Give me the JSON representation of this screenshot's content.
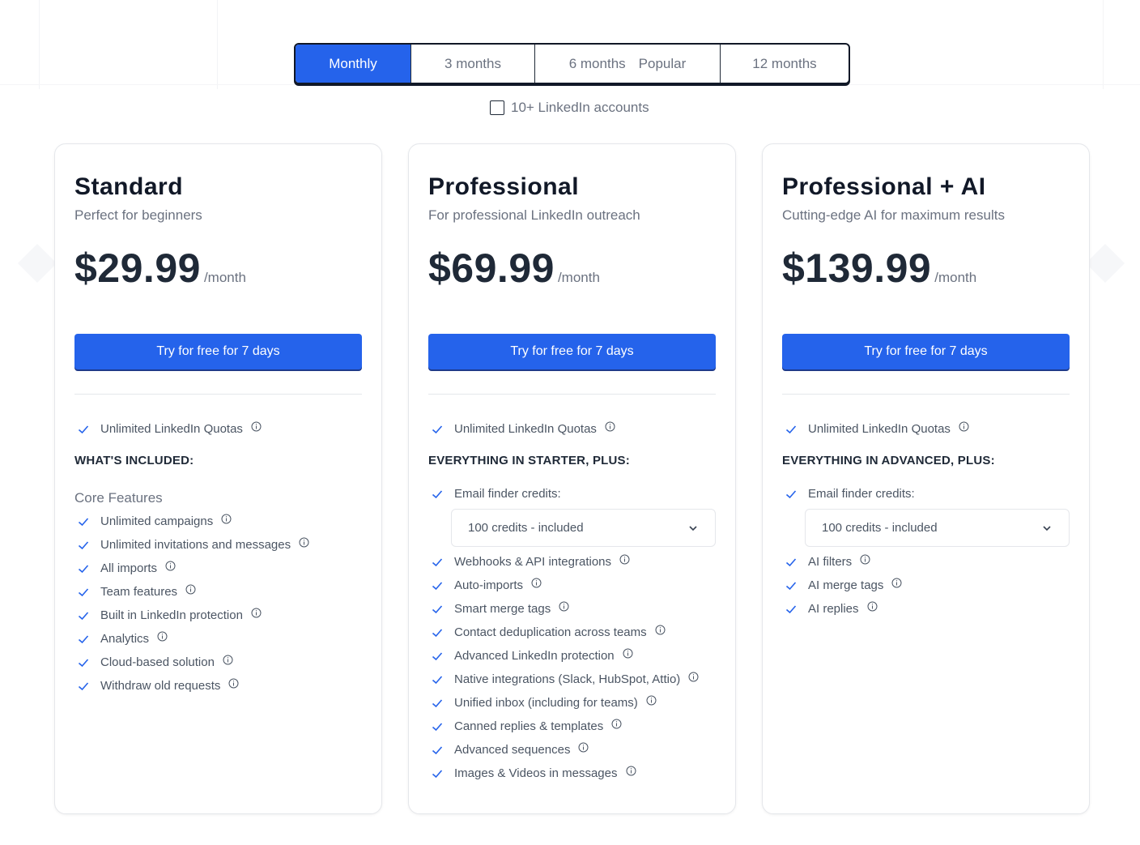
{
  "billing": {
    "options": [
      {
        "label": "Monthly"
      },
      {
        "label": "3 months"
      },
      {
        "label": "6 months",
        "tag": "Popular"
      },
      {
        "label": "12 months"
      }
    ],
    "selected": "Monthly",
    "accounts_label": "10+ LinkedIn accounts",
    "accounts_checked": false
  },
  "colors": {
    "accent": "#2563eb",
    "check": "#2563eb",
    "text": "#1f2937",
    "muted": "#6b7280"
  },
  "plans": [
    {
      "title": "Standard",
      "subtitle": "Perfect for beginners",
      "price": "$29.99",
      "unit": "/month",
      "cta": "Try for free for 7 days",
      "quota": "Unlimited LinkedIn Quotas",
      "heading": "WHAT'S INCLUDED:",
      "group": "Core Features",
      "features": [
        "Unlimited campaigns",
        "Unlimited invitations and messages",
        "All imports",
        "Team features",
        "Built in LinkedIn protection",
        "Analytics",
        "Cloud-based solution",
        "Withdraw old requests"
      ]
    },
    {
      "title": "Professional",
      "subtitle": "For professional LinkedIn outreach",
      "price": "$69.99",
      "unit": "/month",
      "cta": "Try for free for 7 days",
      "quota": "Unlimited LinkedIn Quotas",
      "heading": "EVERYTHING IN STARTER, PLUS:",
      "email_label": "Email finder credits:",
      "credits_value": "100 credits - included",
      "features": [
        "Webhooks & API integrations",
        "Auto-imports",
        "Smart merge tags",
        "Contact deduplication across teams",
        "Advanced LinkedIn protection",
        "Native integrations (Slack, HubSpot, Attio)",
        "Unified inbox (including for teams)",
        "Canned replies & templates",
        "Advanced sequences",
        "Images & Videos in messages"
      ]
    },
    {
      "title": "Professional + AI",
      "subtitle": "Cutting-edge AI for maximum results",
      "price": "$139.99",
      "unit": "/month",
      "cta": "Try for free for 7 days",
      "quota": "Unlimited LinkedIn Quotas",
      "heading": "EVERYTHING IN ADVANCED, PLUS:",
      "email_label": "Email finder credits:",
      "credits_value": "100 credits - included",
      "features": [
        "AI filters",
        "AI merge tags",
        "AI replies"
      ]
    }
  ]
}
